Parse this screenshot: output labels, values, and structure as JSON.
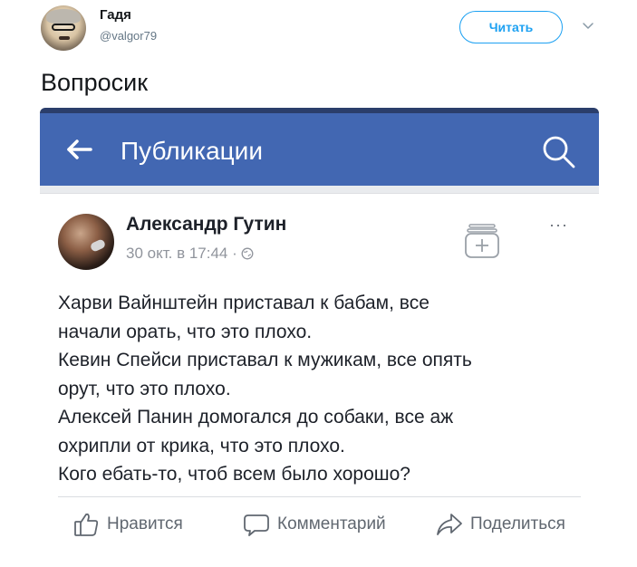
{
  "tweet": {
    "display_name": "Гадя",
    "handle": "@valgor79",
    "follow_label": "Читать",
    "text": "Вопросик"
  },
  "fb": {
    "header_title": "Публикации",
    "author": "Александр Гутин",
    "meta": "30 окт. в 17:44 ·",
    "more": "···",
    "body_lines": [
      "Харви Вайнштейн приставал к бабам, все",
      "начали орать, что это плохо.",
      "Кевин Спейси приставал к мужикам, все опять",
      "орут, что это плохо.",
      "Алексей Панин домогался до собаки, все аж",
      "охрипли от крика, что это плохо.",
      "Кого ебать-то, чтоб всем было хорошо?"
    ],
    "actions": {
      "like": "Нравится",
      "comment": "Комментарий",
      "share": "Поделиться"
    }
  },
  "colors": {
    "twitter_blue": "#1da1f2",
    "facebook_blue": "#4267b2",
    "facebook_dark": "#2b3e6b",
    "muted_text": "#90949c"
  },
  "icons": {
    "back": "arrow-left-icon",
    "search": "search-icon",
    "save": "save-collection-icon",
    "globe": "globe-icon",
    "like": "thumbs-up-icon",
    "comment": "comment-bubble-icon",
    "share": "share-arrow-icon",
    "chevron": "chevron-down-icon"
  }
}
